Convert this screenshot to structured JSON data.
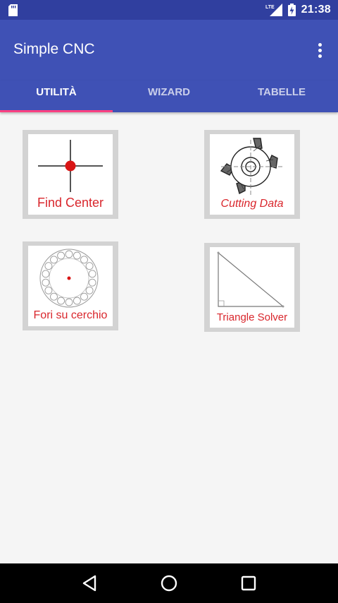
{
  "status_bar": {
    "time": "21:38",
    "network": "LTE",
    "icons": [
      "sd-card-icon",
      "lte-signal-icon",
      "battery-charging-icon"
    ]
  },
  "app_bar": {
    "title": "Simple CNC",
    "overflow_icon": "more-vert-icon"
  },
  "tabs": [
    {
      "label": "UTILITÀ",
      "active": true
    },
    {
      "label": "WIZARD",
      "active": false
    },
    {
      "label": "TABELLE",
      "active": false
    }
  ],
  "tools": [
    {
      "label": "Find Center",
      "icon": "crosshair-icon"
    },
    {
      "label": "Cutting Data",
      "icon": "end-mill-icon"
    },
    {
      "label": "Fori su cerchio",
      "icon": "bolt-circle-icon"
    },
    {
      "label": "Triangle Solver",
      "icon": "right-triangle-icon"
    }
  ],
  "nav_bar": {
    "icons": [
      "back-icon",
      "home-icon",
      "recents-icon"
    ]
  },
  "colors": {
    "primary": "#3f51b5",
    "primary_dark": "#303f9f",
    "accent": "#ff4081",
    "tile_label": "#d9262c"
  }
}
